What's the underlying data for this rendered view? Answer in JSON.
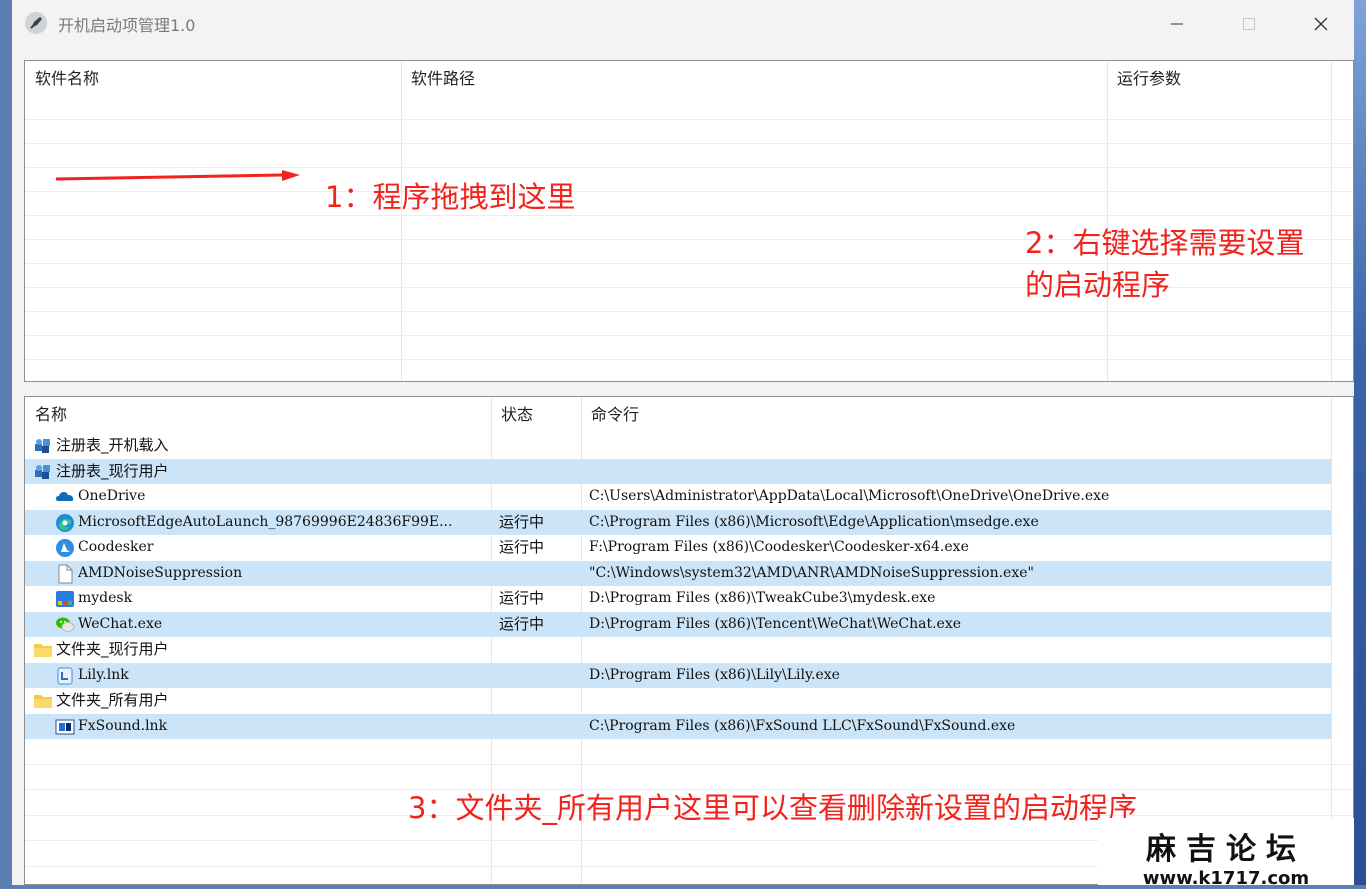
{
  "window": {
    "title": "开机启动项管理1.0"
  },
  "top_table": {
    "columns": [
      "软件名称",
      "软件路径",
      "运行参数"
    ]
  },
  "bottom_table": {
    "columns": [
      "名称",
      "状态",
      "命令行"
    ],
    "rows": [
      {
        "name": "注册表_开机载入",
        "status": "",
        "command": "",
        "icon": "registry-icon",
        "level": 0,
        "selected": false
      },
      {
        "name": "注册表_现行用户",
        "status": "",
        "command": "",
        "icon": "registry-icon",
        "level": 0,
        "selected": true
      },
      {
        "name": "OneDrive",
        "status": "",
        "command": "C:\\Users\\Administrator\\AppData\\Local\\Microsoft\\OneDrive\\OneDrive.exe",
        "icon": "onedrive-icon",
        "level": 1,
        "selected": false
      },
      {
        "name": "MicrosoftEdgeAutoLaunch_98769996E24836F99E...",
        "status": "运行中",
        "command": "C:\\Program Files (x86)\\Microsoft\\Edge\\Application\\msedge.exe",
        "icon": "edge-icon",
        "level": 1,
        "selected": true
      },
      {
        "name": "Coodesker",
        "status": "运行中",
        "command": "F:\\Program Files (x86)\\Coodesker\\Coodesker-x64.exe",
        "icon": "coodesker-icon",
        "level": 1,
        "selected": false
      },
      {
        "name": "AMDNoiseSuppression",
        "status": "",
        "command": "\"C:\\Windows\\system32\\AMD\\ANR\\AMDNoiseSuppression.exe\"",
        "icon": "file-icon",
        "level": 1,
        "selected": true
      },
      {
        "name": "mydesk",
        "status": "运行中",
        "command": "D:\\Program Files (x86)\\TweakCube3\\mydesk.exe",
        "icon": "mydesk-icon",
        "level": 1,
        "selected": false
      },
      {
        "name": "WeChat.exe",
        "status": "运行中",
        "command": "D:\\Program Files (x86)\\Tencent\\WeChat\\WeChat.exe",
        "icon": "wechat-icon",
        "level": 1,
        "selected": true
      },
      {
        "name": "文件夹_现行用户",
        "status": "",
        "command": "",
        "icon": "folder-icon",
        "level": 0,
        "selected": false
      },
      {
        "name": "Lily.lnk",
        "status": "",
        "command": "D:\\Program Files (x86)\\Lily\\Lily.exe",
        "icon": "lily-icon",
        "level": 1,
        "selected": true
      },
      {
        "name": "文件夹_所有用户",
        "status": "",
        "command": "",
        "icon": "folder-icon",
        "level": 0,
        "selected": false
      },
      {
        "name": "FxSound.lnk",
        "status": "",
        "command": "C:\\Program Files (x86)\\FxSound LLC\\FxSound\\FxSound.exe",
        "icon": "fxsound-icon",
        "level": 1,
        "selected": true
      }
    ]
  },
  "annotations": {
    "step1": "1：程序拖拽到这里",
    "step2_line1": "2：右键选择需要设置",
    "step2_line2": "的启动程序",
    "step3": "3：文件夹_所有用户这里可以查看删除新设置的启动程序"
  },
  "watermark": {
    "title": "麻吉论坛",
    "url": "www.k1717.com"
  },
  "colors": {
    "annotation": "#f2231c",
    "selected_row": "#cce4f7",
    "window_bg": "#f3f3f3"
  }
}
